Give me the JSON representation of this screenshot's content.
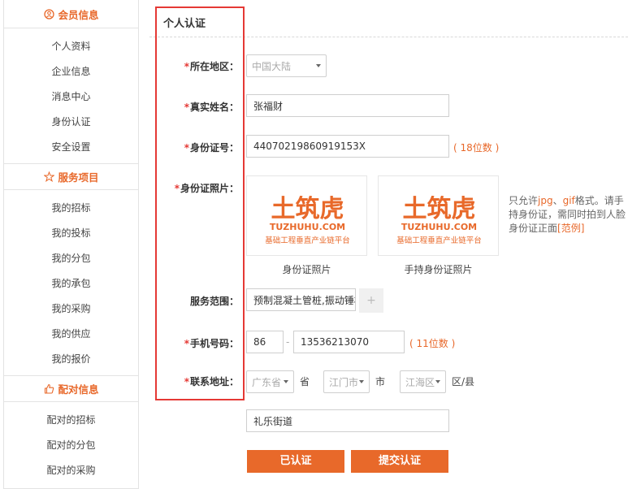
{
  "sidebar": {
    "sections": [
      {
        "title": "会员信息",
        "icon": "member-icon",
        "items": [
          "个人资料",
          "企业信息",
          "消息中心",
          "身份认证",
          "安全设置"
        ]
      },
      {
        "title": "服务项目",
        "icon": "star-icon",
        "items": [
          "我的招标",
          "我的投标",
          "我的分包",
          "我的承包",
          "我的采购",
          "我的供应",
          "我的报价"
        ]
      },
      {
        "title": "配对信息",
        "icon": "thumbs-up-icon",
        "items": [
          "配对的招标",
          "配对的分包",
          "配对的采购"
        ]
      }
    ]
  },
  "form": {
    "title": "个人认证",
    "required_mark": "*",
    "region": {
      "label": "所在地区：",
      "value": "中国大陆"
    },
    "name": {
      "label": "真实姓名：",
      "value": "张福财"
    },
    "id_number": {
      "label": "身份证号：",
      "value": "44070219860919153X",
      "hint": "( 18位数 )"
    },
    "id_photo": {
      "label": "身份证照片：",
      "photos": [
        {
          "caption": "身份证照片",
          "logo_main": "土筑虎",
          "logo_domain": "TUZHUHU.COM",
          "logo_slogan": "基础工程垂直产业链平台"
        },
        {
          "caption": "手持身份证照片",
          "logo_main": "土筑虎",
          "logo_domain": "TUZHUHU.COM",
          "logo_slogan": "基础工程垂直产业链平台"
        }
      ],
      "note_prefix": "只允许",
      "note_fmt1": "jpg",
      "note_sep": "、",
      "note_fmt2": "gif",
      "note_rest": "格式。请手持身份证，需同时拍到人脸身份证正面",
      "note_link": "[范例]"
    },
    "service": {
      "label": "服务范围：",
      "value": "预制混凝土管桩,振动锤桩",
      "add": "+"
    },
    "phone": {
      "label": "手机号码：",
      "code": "86",
      "dash": "-",
      "value": "13536213070",
      "hint": "( 11位数 )"
    },
    "address": {
      "label": "联系地址：",
      "province": "广东省",
      "province_unit": "省",
      "city": "江门市",
      "city_unit": "市",
      "district": "江海区",
      "district_unit": "区/县",
      "street": "礼乐街道"
    },
    "buttons": {
      "verified": "已认证",
      "submit": "提交认证"
    }
  },
  "colors": {
    "accent": "#e8692a",
    "highlight_border": "#e53935"
  }
}
